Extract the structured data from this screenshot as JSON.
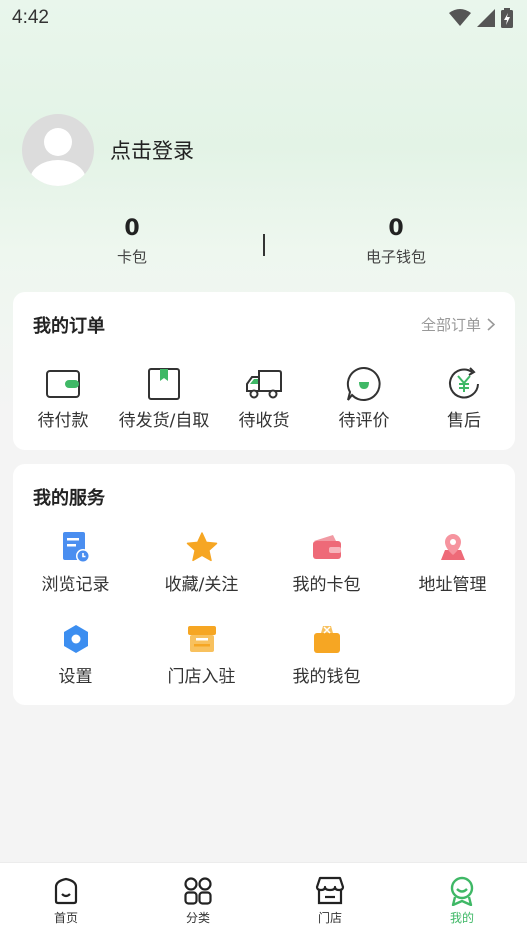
{
  "status_bar": {
    "time": "4:42"
  },
  "profile": {
    "login_text": "点击登录"
  },
  "stats": [
    {
      "value": "0",
      "label": "卡包"
    },
    {
      "value": "0",
      "label": "电子钱包"
    }
  ],
  "orders": {
    "title": "我的订单",
    "all_label": "全部订单",
    "items": [
      {
        "label": "待付款",
        "icon": "wallet-icon"
      },
      {
        "label": "待发货/自取",
        "icon": "bookmark-box-icon"
      },
      {
        "label": "待收货",
        "icon": "truck-icon"
      },
      {
        "label": "待评价",
        "icon": "comment-icon"
      },
      {
        "label": "售后",
        "icon": "yuan-refund-icon"
      }
    ]
  },
  "services": {
    "title": "我的服务",
    "items": [
      {
        "label": "浏览记录",
        "icon": "history-icon"
      },
      {
        "label": "收藏/关注",
        "icon": "star-icon"
      },
      {
        "label": "我的卡包",
        "icon": "card-wallet-icon"
      },
      {
        "label": "地址管理",
        "icon": "location-icon"
      },
      {
        "label": "设置",
        "icon": "settings-icon"
      },
      {
        "label": "门店入驻",
        "icon": "store-join-icon"
      },
      {
        "label": "我的钱包",
        "icon": "purse-icon"
      }
    ]
  },
  "tabbar": {
    "accent_color": "#3fb866",
    "items": [
      {
        "label": "首页",
        "icon": "home-icon"
      },
      {
        "label": "分类",
        "icon": "category-icon"
      },
      {
        "label": "门店",
        "icon": "store-icon"
      },
      {
        "label": "我的",
        "icon": "profile-icon",
        "active": true
      }
    ]
  }
}
